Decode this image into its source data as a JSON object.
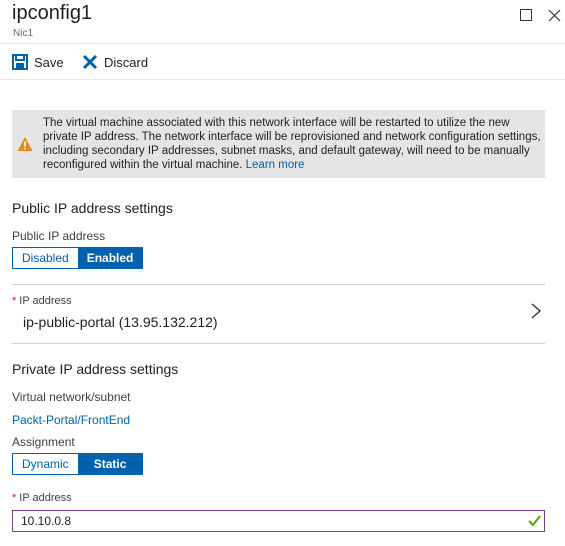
{
  "header": {
    "title": "ipconfig1",
    "subtitle": "Nic1"
  },
  "toolbar": {
    "save_label": "Save",
    "discard_label": "Discard"
  },
  "warning": {
    "text": "The virtual machine associated with this network interface will be restarted to utilize the new private IP address. The network interface will be reprovisioned and network configuration settings, including secondary IP addresses, subnet masks, and default gateway, will need to be manually reconfigured within the virtual machine.",
    "link": "Learn more"
  },
  "public": {
    "section_title": "Public IP address settings",
    "field_label": "Public IP address",
    "options": [
      "Disabled",
      "Enabled"
    ],
    "selected": "Enabled",
    "ip_label": "IP address",
    "ip_value": "ip-public-portal (13.95.132.212)"
  },
  "private": {
    "section_title": "Private IP address settings",
    "vnet_label": "Virtual network/subnet",
    "vnet_value": "Packt-Portal/FrontEnd",
    "assignment_label": "Assignment",
    "options": [
      "Dynamic",
      "Static"
    ],
    "selected": "Static",
    "ip_label": "IP address",
    "ip_value": "10.10.0.8"
  },
  "icons": {
    "save": "save-icon",
    "discard": "discard-icon",
    "warning": "warning-icon",
    "chevron": "chevron-right-icon",
    "valid": "checkmark-icon"
  },
  "colors": {
    "accent": "#0062ad",
    "warning": "#e8891b",
    "valid": "#57a300",
    "required": "#e00b1c"
  }
}
